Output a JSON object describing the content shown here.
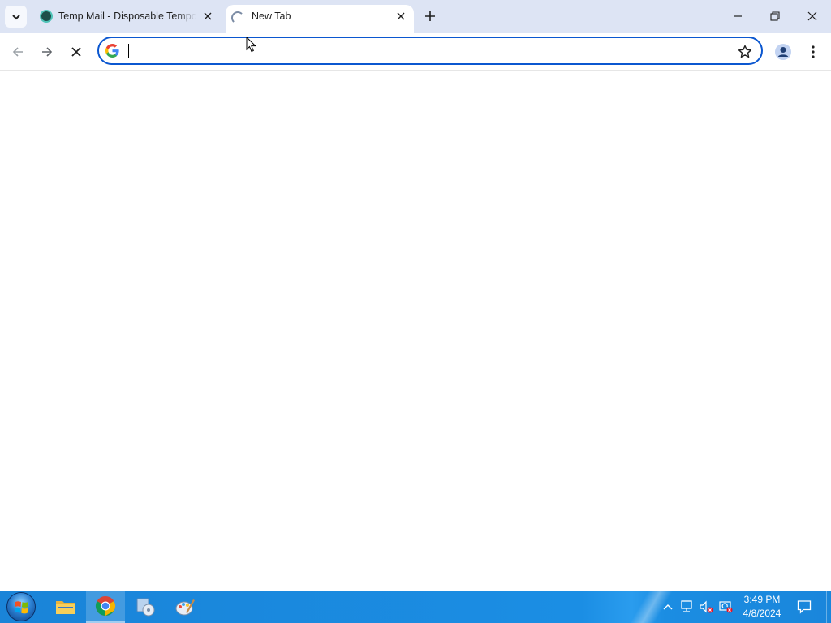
{
  "browser": {
    "tabs": [
      {
        "title": "Temp Mail - Disposable Temporary Email",
        "state": "inactive",
        "favicon": "tempmail-favicon-icon"
      },
      {
        "title": "New Tab",
        "state": "active-loading",
        "favicon": "loading-spinner-icon"
      }
    ],
    "tab_search_icon": "chevron-down-icon",
    "new_tab_icon": "plus-icon",
    "window_controls": [
      "minimize-icon",
      "restore-icon",
      "close-icon"
    ],
    "toolbar": {
      "back_icon": "arrow-left-icon",
      "forward_icon": "arrow-right-icon",
      "stop_icon": "close-icon"
    },
    "omnibox": {
      "value": "",
      "search_engine_icon": "google-g-icon",
      "bookmark_icon": "star-outline-icon"
    },
    "profile_icon": "person-icon",
    "menu_icon": "kebab-menu-icon",
    "accent_color": "#0b57d0",
    "tabstrip_color": "#dde4f4"
  },
  "taskbar": {
    "start_icon": "windows-start-orb-icon",
    "pinned": [
      {
        "name": "file-explorer",
        "icon": "folder-icon",
        "active": false
      },
      {
        "name": "google-chrome",
        "icon": "chrome-icon",
        "active": true
      },
      {
        "name": "app-3",
        "icon": "installer-icon",
        "active": false
      },
      {
        "name": "app-4",
        "icon": "paint-icon",
        "active": false
      }
    ],
    "tray": {
      "icons": [
        "chevron-up-icon",
        "network-icon",
        "volume-muted-icon",
        "security-icon"
      ],
      "time": "3:49 PM",
      "date": "4/8/2024"
    },
    "notification_icon": "notification-icon",
    "color": "#1a86db"
  }
}
